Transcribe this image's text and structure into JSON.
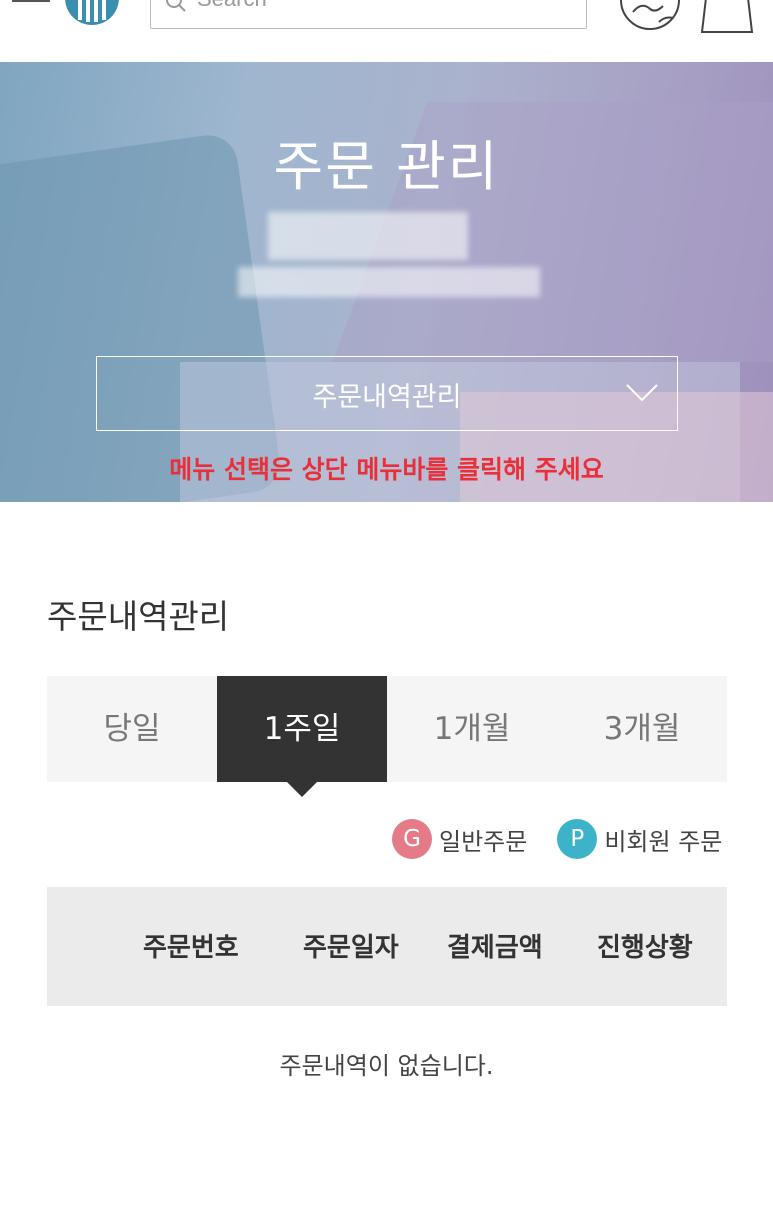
{
  "header": {
    "search_placeholder": "Search",
    "menu_icon": "hamburger-icon",
    "logo_icon": "brand-logo",
    "account_icon": "globe-user-icon",
    "cart_icon": "shopping-bag-icon"
  },
  "hero": {
    "title": "주문 관리",
    "dropdown_selected": "주문내역관리",
    "notice": "메뉴 선택은 상단 메뉴바를 클릭해 주세요",
    "notice_color": "#e8303a"
  },
  "main": {
    "section_title": "주문내역관리",
    "tabs": [
      {
        "label": "당일"
      },
      {
        "label": "1주일"
      },
      {
        "label": "1개월"
      },
      {
        "label": "3개월"
      }
    ],
    "active_tab": "1주일",
    "legend": [
      {
        "badge": "G",
        "label": "일반주문",
        "color": "#e57b89"
      },
      {
        "badge": "P",
        "label": "비회원 주문",
        "color": "#3cb3c9"
      }
    ],
    "table_headers": [
      "주문번호",
      "주문일자",
      "결제금액",
      "진행상황"
    ],
    "empty_message": "주문내역이 없습니다."
  }
}
